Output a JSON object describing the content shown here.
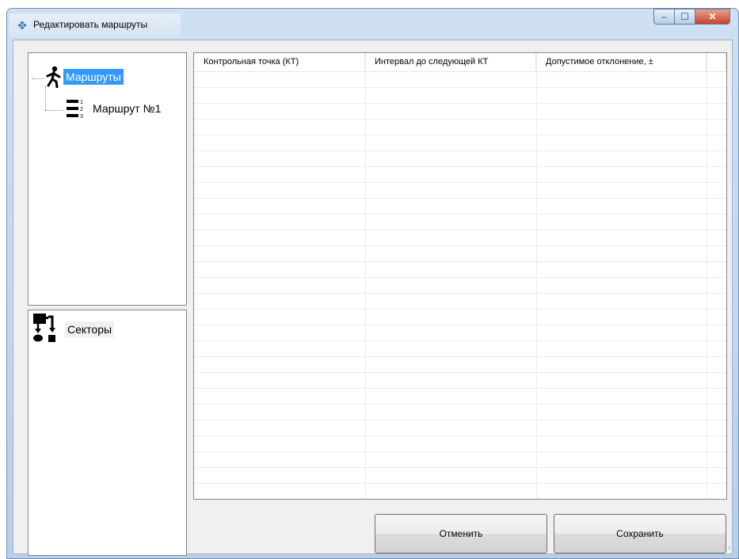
{
  "window": {
    "title": "Редактировать маршруты",
    "controls": {
      "minimize": "–",
      "maximize": "☐",
      "close": "✕"
    }
  },
  "routes_tree": {
    "root_label": "Маршруты",
    "root_icon": "walking-person-icon",
    "children": [
      {
        "label": "Маршрут №1",
        "icon": "numbered-list-icon"
      }
    ]
  },
  "sectors_tree": {
    "root_label": "Секторы",
    "root_icon": "sectors-flow-icon"
  },
  "grid": {
    "columns": [
      "Контрольная точка (КТ)",
      "Интервал до следующей КТ",
      "Допустимое отклонение, ±"
    ],
    "rows": []
  },
  "buttons": {
    "cancel": "Отменить",
    "save": "Сохранить"
  },
  "colors": {
    "selection": "#3399ff",
    "window_frame": "#b9cfe8",
    "close_button": "#c7432a"
  }
}
